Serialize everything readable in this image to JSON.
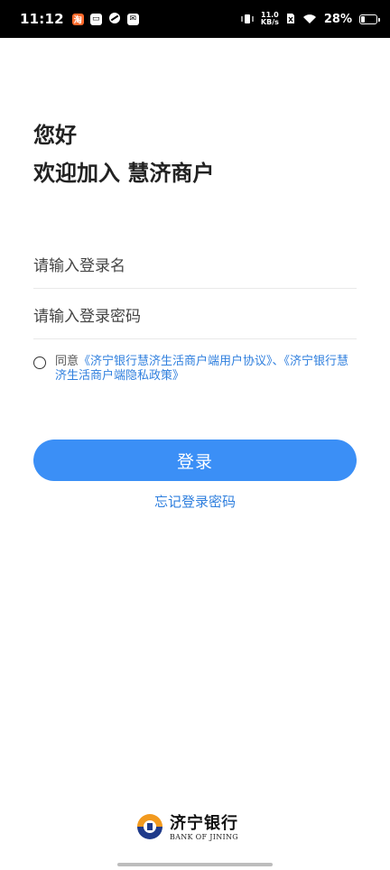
{
  "status_bar": {
    "time": "11:12",
    "net_speed_value": "11.0",
    "net_speed_unit": "KB/s",
    "battery": "28%",
    "battery_level": 0.28,
    "app_icons": [
      "taobao-icon",
      "store-icon",
      "link-icon",
      "mail-icon"
    ]
  },
  "greeting": {
    "line1": "您好",
    "line2": "欢迎加入 慧济商户"
  },
  "form": {
    "username_placeholder": "请输入登录名",
    "password_placeholder": "请输入登录密码"
  },
  "agreement": {
    "prefix": "同意",
    "link1": "《济宁银行慧济生活商户端用户协议》",
    "separator": "、",
    "link2": "《济宁银行慧济生活商户端隐私政策》",
    "checked": false
  },
  "login_button": "登录",
  "forgot_password": "忘记登录密码",
  "brand": {
    "name_cn": "济宁银行",
    "name_en": "BANK OF JINING"
  },
  "colors": {
    "accent": "#3b8ff6",
    "link": "#2f7fde",
    "logo_orange": "#f29a1f",
    "logo_navy": "#1f3a8a"
  }
}
